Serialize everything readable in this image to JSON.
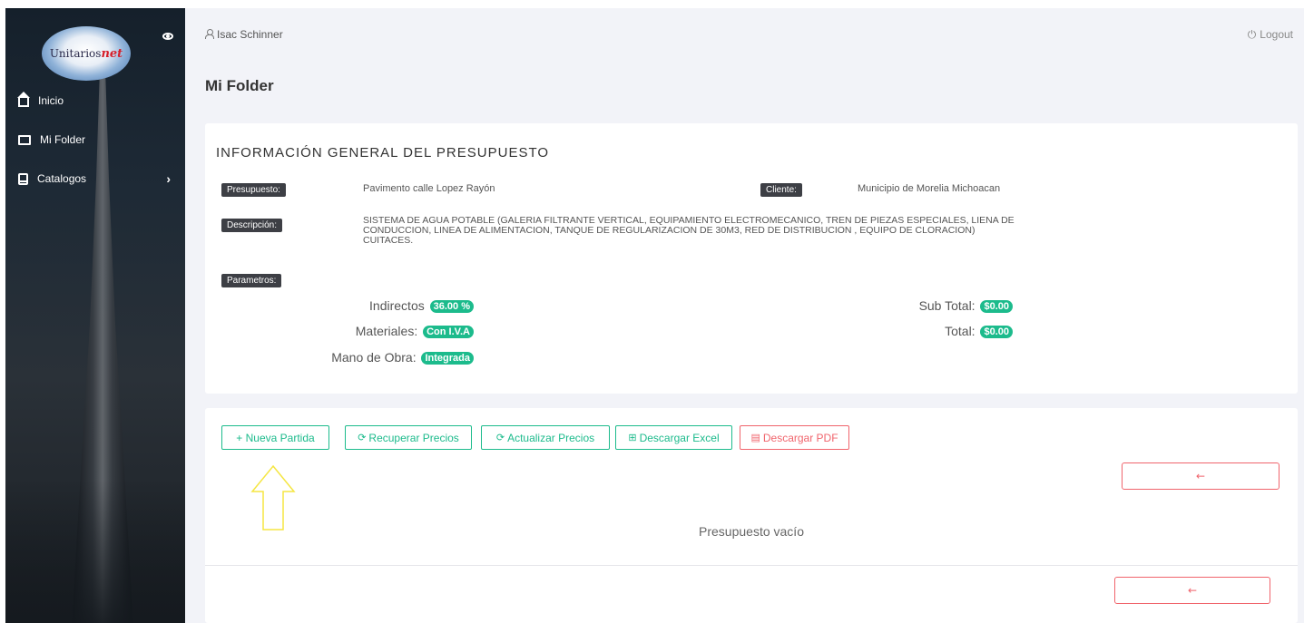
{
  "sidebar": {
    "logo_text": "Unitarios",
    "logo_accent": "net",
    "items": [
      {
        "label": "Inicio",
        "icon": "home-icon"
      },
      {
        "label": "Mi Folder",
        "icon": "folder-icon"
      },
      {
        "label": "Catalogos",
        "icon": "book-icon"
      }
    ]
  },
  "header": {
    "user": "Isac Schinner",
    "logout": "Logout"
  },
  "page": {
    "title": "Mi Folder"
  },
  "info": {
    "title": "INFORMACIÓN GENERAL DEL PRESUPUESTO",
    "presupuesto_label": "Presupuesto:",
    "presupuesto_value": "Pavimento calle Lopez Rayón",
    "cliente_label": "Cliente:",
    "cliente_value": "Municipio de Morelia Michoacan",
    "descripcion_label": "Descripción:",
    "descripcion_value": "SISTEMA DE AGUA POTABLE (GALERIA FILTRANTE VERTICAL, EQUIPAMIENTO ELECTROMECANICO, TREN DE PIEZAS ESPECIALES, LIENA DE CONDUCCION, LINEA DE ALIMENTACION, TANQUE DE REGULARIZACION DE 30M3, RED DE DISTRIBUCION , EQUIPO DE CLORACION) CUITACES.",
    "parametros_label": "Parametros:",
    "indirectos_label": "Indirectos",
    "indirectos_value": "36.00 %",
    "materiales_label": "Materiales:",
    "materiales_value": "Con I.V.A",
    "mano_obra_label": "Mano de Obra:",
    "mano_obra_value": "Integrada",
    "subtotal_label": "Sub Total:",
    "subtotal_value": "$0.00",
    "total_label": "Total:",
    "total_value": "$0.00"
  },
  "actions": {
    "nueva_partida": "+ Nueva Partida",
    "recuperar_precios": "Recuperar Precios",
    "actualizar_precios": "Actualizar Precios",
    "descargar_excel": "Descargar Excel",
    "descargar_pdf": "Descargar PDF",
    "back_arrow": "←"
  },
  "content": {
    "empty_message": "Presupuesto vacío"
  },
  "colors": {
    "accent": "#1cbb8c",
    "danger": "#f0646c",
    "sidebar": "#1e2a36",
    "background": "#f2f3f8",
    "annotation": "#f5e642"
  }
}
